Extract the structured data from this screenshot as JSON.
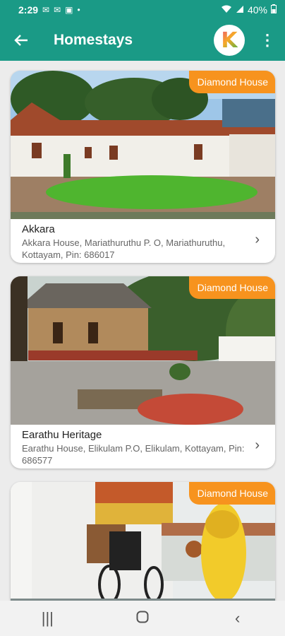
{
  "status_bar": {
    "time": "2:29",
    "battery": "40%",
    "left_icons": [
      "gmail-icon",
      "gmail-icon",
      "photos-icon",
      "dot-icon"
    ],
    "right_icons": [
      "wifi-icon",
      "signal-icon",
      "battery-icon"
    ]
  },
  "app_bar": {
    "title": "Homestays",
    "logo_letter": "K",
    "accent_color": "#1a9a86"
  },
  "badge_color": "#f7931e",
  "listings": [
    {
      "badge": "Diamond House",
      "name": "Akkara",
      "address": "Akkara House, Mariathuruthu P. O, Mariathuruthu, Kottayam, Pin: 686017"
    },
    {
      "badge": "Diamond House",
      "name": "Earathu Heritage",
      "address": "Earathu House, Elikulam P.O, Elikulam, Kottayam, Pin: 686577"
    },
    {
      "badge": "Diamond House",
      "name": "",
      "address": ""
    }
  ]
}
